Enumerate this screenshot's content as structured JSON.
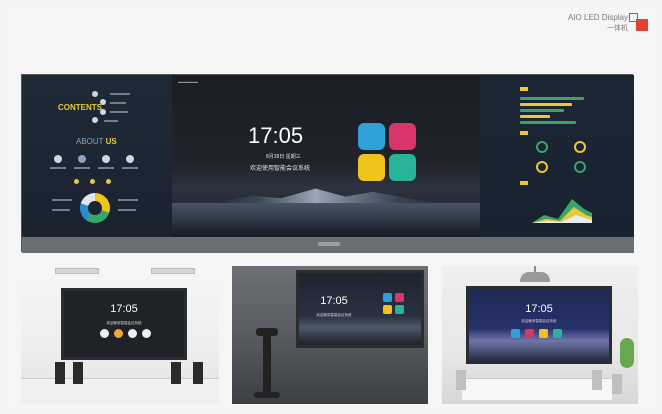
{
  "brand": {
    "title": "AIO LED Display",
    "subtitle": "一体机"
  },
  "wide_display": {
    "left_panel": {
      "contents_title": "CONTENTS",
      "about_prefix": "ABOUT",
      "about_word": "US"
    },
    "center": {
      "time": "17:05",
      "date": "8月28日 星期三",
      "welcome": "欢迎使用智能会议系统",
      "tile_colors": [
        "#2fa0d8",
        "#d9356b",
        "#f1c21a",
        "#2bb39a"
      ]
    }
  },
  "photos": [
    {
      "time": "17:05",
      "subtitle": "欢迎使用智能会议系统"
    },
    {
      "time": "17:05",
      "subtitle": "欢迎使用智能会议系统"
    },
    {
      "time": "17:05",
      "subtitle": "欢迎使用智能会议系统"
    }
  ],
  "colors": {
    "accent_red": "#d9432f",
    "accent_yellow": "#e9c93a"
  }
}
